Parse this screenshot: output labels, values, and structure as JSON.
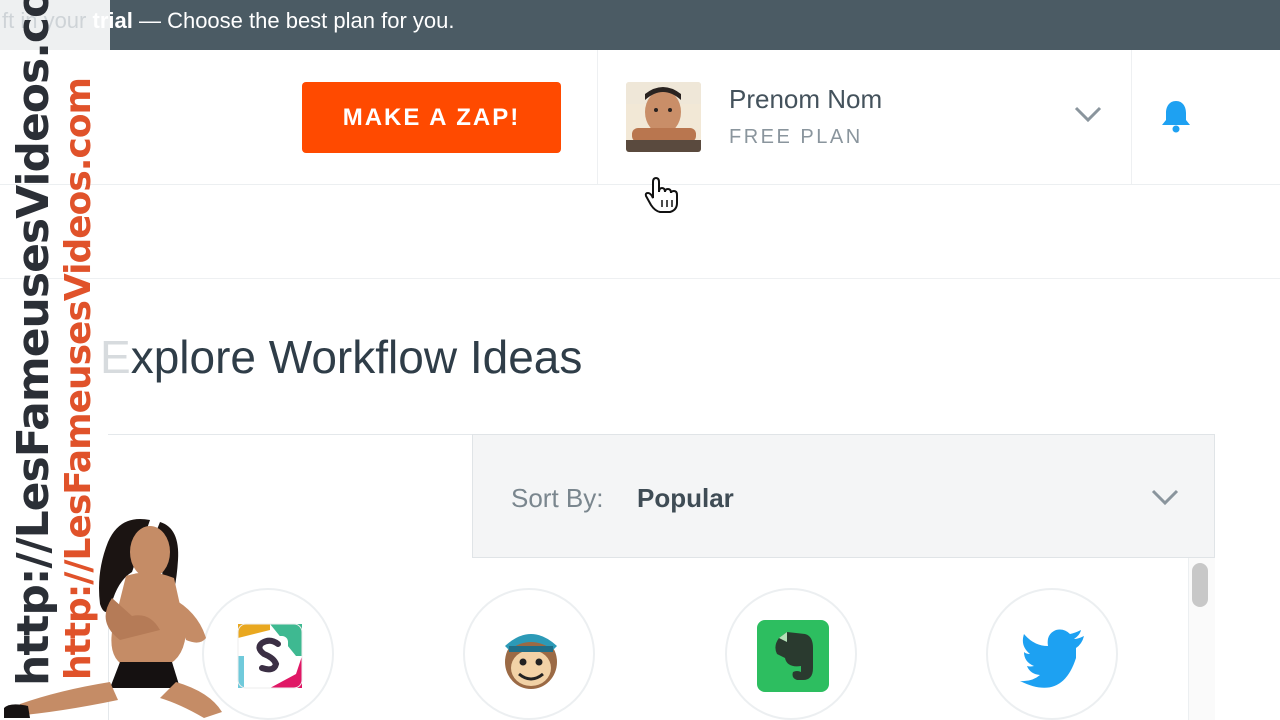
{
  "banner": {
    "prefix_faded": "ft in your",
    "prefix_bold": " trial",
    "message": " — Choose the best plan for you."
  },
  "header": {
    "make_zap_label": "MAKE A ZAP!",
    "user_name": "Prenom Nom",
    "user_plan": "FREE PLAN"
  },
  "page": {
    "title_ghost": "E",
    "title_visible": "xplore Workflow Ideas"
  },
  "filter": {
    "sort_label": "Sort By:",
    "sort_value": "Popular"
  },
  "apps": [
    {
      "name": "Slack",
      "icon": "slack-icon",
      "color": "#3eb991"
    },
    {
      "name": "MailChimp",
      "icon": "mailchimp-icon",
      "color": "#2c9ab7"
    },
    {
      "name": "Evernote",
      "icon": "evernote-icon",
      "color": "#2dbe60"
    },
    {
      "name": "Twitter",
      "icon": "twitter-icon",
      "color": "#1da1f2"
    }
  ],
  "watermark": {
    "line1": "http://LesFameusesVideos.com",
    "line2": "http://LesFameusesVideos.com"
  },
  "colors": {
    "accent": "#ff4a00",
    "banner": "#4b5b64",
    "bell": "#1ea1f2"
  }
}
